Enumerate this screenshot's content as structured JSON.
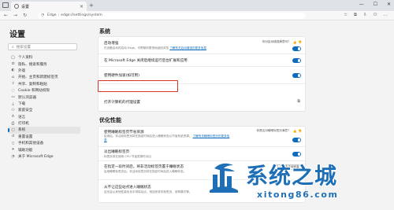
{
  "browser": {
    "tab_title": "设置",
    "tab_close": "×",
    "new_tab": "+",
    "address_prefix": "Edge",
    "address_sep": "|",
    "address_url": "edge://settings/system",
    "nav": {
      "back": "←",
      "forward": "→",
      "refresh": "↻"
    },
    "window": {
      "minimize": "—",
      "maximize": "☐",
      "close": "✕"
    },
    "tools": [
      "☆",
      "⧉",
      "⇩",
      "⚇",
      "…"
    ]
  },
  "sidebar": {
    "title": "设置",
    "search_placeholder": "搜索设置",
    "items": [
      {
        "icon": "user-icon",
        "glyph": "◯",
        "label": "个人资料"
      },
      {
        "icon": "lock-icon",
        "glyph": "⊡",
        "label": "隐私、搜索和服务"
      },
      {
        "icon": "appearance-icon",
        "glyph": "◐",
        "label": "外观"
      },
      {
        "icon": "start-icon",
        "glyph": "⌂",
        "label": "开始、主页和新建标签页"
      },
      {
        "icon": "share-icon",
        "glyph": "⇪",
        "label": "共享、复制和粘贴"
      },
      {
        "icon": "cookie-icon",
        "glyph": "◌",
        "label": "Cookie 和网站权限"
      },
      {
        "icon": "browser-icon",
        "glyph": "▭",
        "label": "默认浏览器"
      },
      {
        "icon": "download-icon",
        "glyph": "⤓",
        "label": "下载"
      },
      {
        "icon": "family-icon",
        "glyph": "⚇",
        "label": "家庭安全"
      },
      {
        "icon": "language-icon",
        "glyph": "A",
        "label": "语言"
      },
      {
        "icon": "printer-icon",
        "glyph": "⎙",
        "label": "打印机"
      },
      {
        "icon": "system-icon",
        "glyph": "▢",
        "label": "系统",
        "active": true
      },
      {
        "icon": "reset-icon",
        "glyph": "↺",
        "label": "重置设置"
      },
      {
        "icon": "phone-icon",
        "glyph": "▯",
        "label": "手机和其他设备"
      },
      {
        "icon": "accessibility-icon",
        "glyph": "✦",
        "label": "辅助功能"
      },
      {
        "icon": "edge-icon",
        "glyph": "◔",
        "label": "关于 Microsoft Edge"
      }
    ]
  },
  "system": {
    "title": "系统",
    "rows": [
      {
        "label": "启动增强",
        "sub": "在设备启动时启动 Edge，可帮助你更快地返回浏览",
        "sub_link": "了解有关启动增强的更多信息",
        "note": "你对启动增强满意吗?",
        "thumbs": "👍  👎"
      },
      {
        "label": "在 Microsoft Edge 关闭后继续运行后台扩展和应用"
      },
      {
        "label": "使用硬件加速(如可用)"
      },
      {
        "label": "打开计算机的代理设置",
        "ext": "⧉"
      }
    ]
  },
  "perf": {
    "title": "优化性能",
    "rows": [
      {
        "label": "使用睡眠标签页节省资源",
        "sub": "启用后，非活动标签页将在指定时间后进入睡眠状态以节省系统资源。",
        "sub_link": "了解有关睡眠标签页的更多信息",
        "note": "你是否对睡眠标签页满意?",
        "thumbs": "👍  👎"
      },
      {
        "label": "淡出睡眠标签页",
        "sub": "标签页将在使用 CPU 节省资源时淡出"
      },
      {
        "label": "在指定一段时间后，将非活动标签页置于睡眠状态",
        "sub": "启用睡眠标签页后，非活动标签页将在指定时间后进入睡眠状态。",
        "select": "2 小时非活动状态"
      },
      {
        "label": "从不让这些站点进入睡眠状态",
        "sub": "这也会从其他性能优化中排除站点，例如丢弃的标签页、效率模式等。"
      }
    ]
  },
  "watermark": {
    "text": "系统之城",
    "url": "xitong86.com"
  }
}
